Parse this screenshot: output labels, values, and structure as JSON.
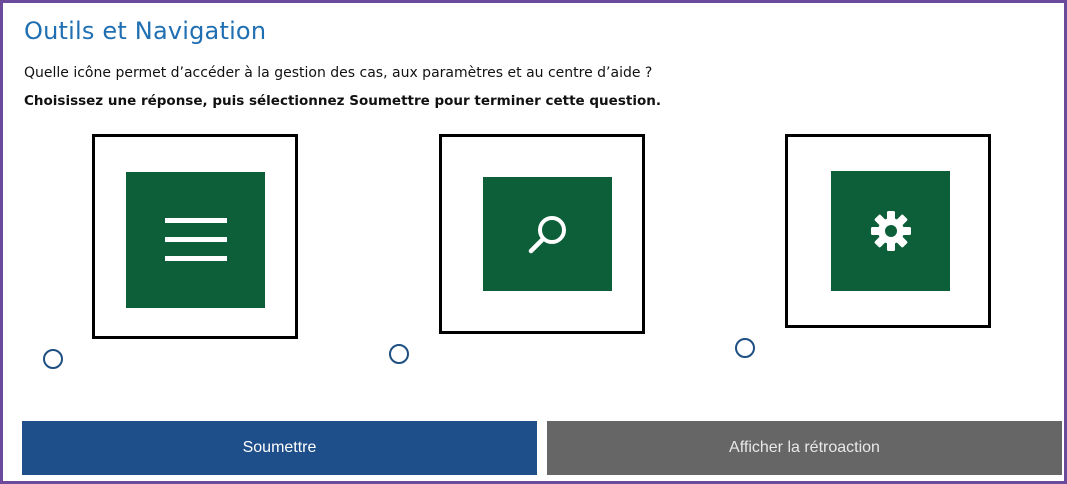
{
  "title": "Outils et Navigation",
  "question": "Quelle icône permet d’accéder à la gestion des cas, aux paramètres et au centre d’aide ?",
  "instruction": "Choisissez une réponse, puis sélectionnez Soumettre pour terminer cette question.",
  "choices": [
    {
      "icon": "hamburger-menu-icon",
      "selected": false
    },
    {
      "icon": "search-icon",
      "selected": false
    },
    {
      "icon": "gear-icon",
      "selected": false
    }
  ],
  "buttons": {
    "submit_label": "Soumettre",
    "feedback_label": "Afficher la rétroaction"
  },
  "colors": {
    "title": "#1f6fb2",
    "tile_green": "#0d5f3a",
    "submit_bg": "#1e4f8a",
    "feedback_bg": "#666666",
    "frame_border": "#6b4a9b",
    "radio_border": "#1e4f82"
  }
}
